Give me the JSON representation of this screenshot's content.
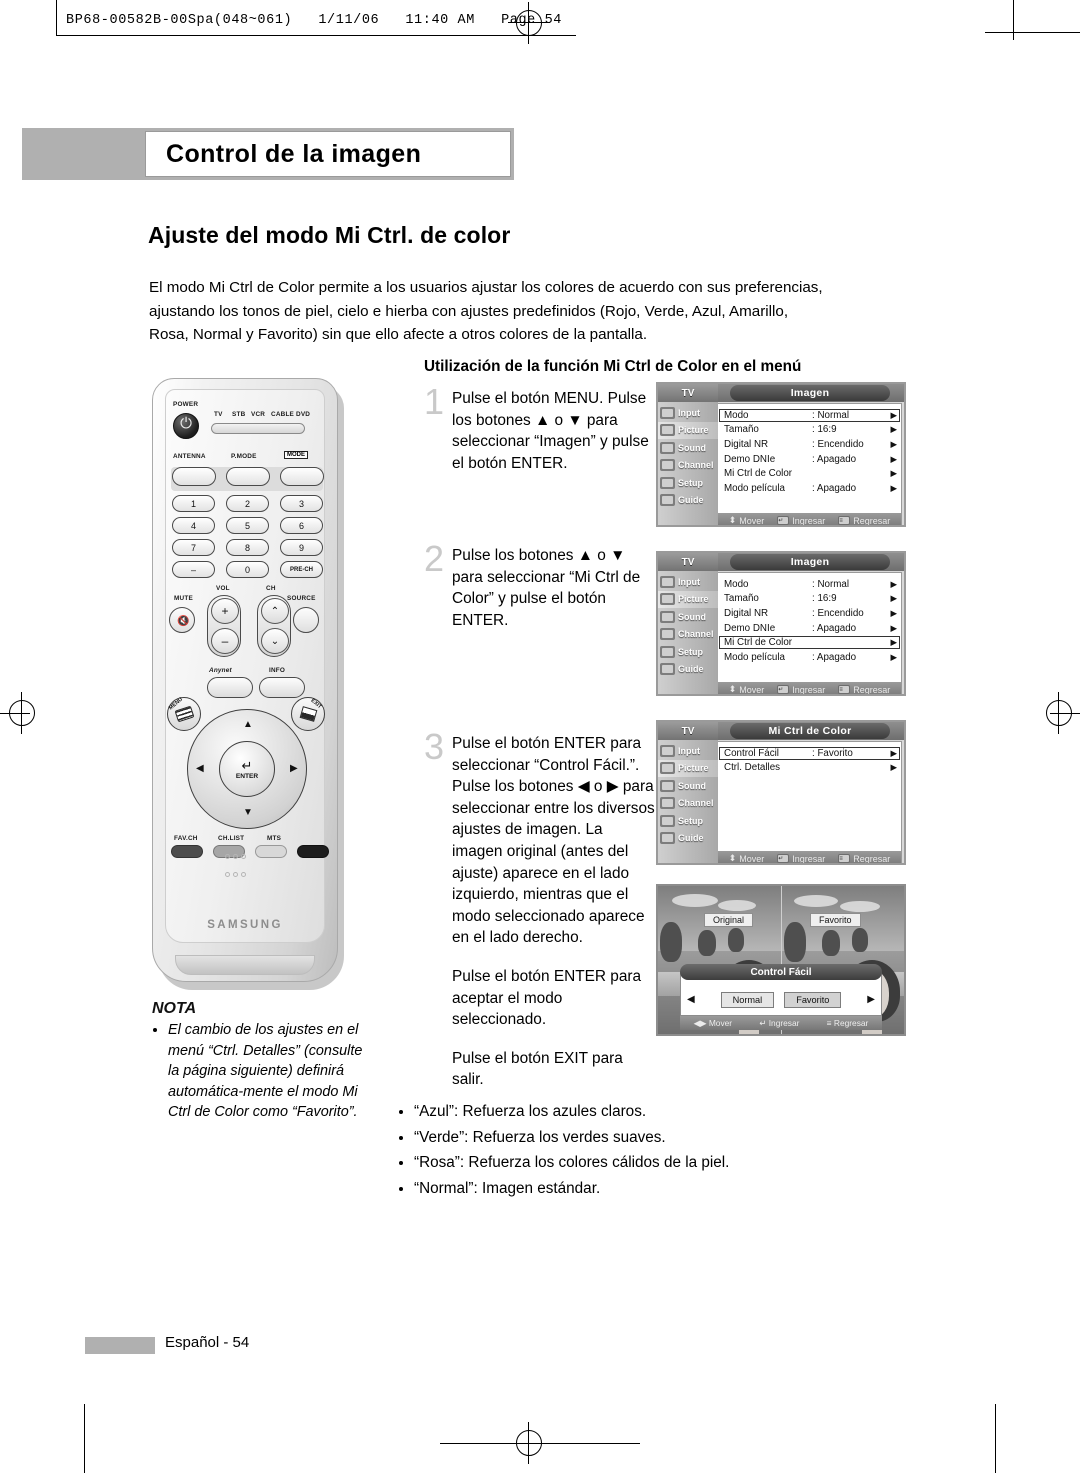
{
  "page_header": {
    "text": "BP68-00582B-00Spa(048~061)   1/11/06   11:40 AM   Page 54"
  },
  "chapter": {
    "title": "Control de la imagen"
  },
  "section": {
    "heading": "Ajuste del modo Mi Ctrl. de color"
  },
  "intro": {
    "lines": [
      "El modo Mi Ctrl de Color permite a los usuarios ajustar los colores de acuerdo con sus preferencias,",
      "ajustando los tonos de piel, cielo e hierba con ajustes predefinidos (Rojo, Verde, Azul, Amarillo,",
      "Rosa, Normal y Favorito) sin que ello afecte a otros colores de la pantalla."
    ]
  },
  "sub_heading": "Utilización de la función Mi Ctrl de Color en el menú",
  "steps": [
    {
      "number": "1",
      "paragraphs": [
        "Pulse el botón MENU.  Pulse los botones ▲ o ▼ para seleccionar “Imagen” y pulse el botón ENTER."
      ]
    },
    {
      "number": "2",
      "paragraphs": [
        "Pulse los botones ▲ o ▼ para seleccionar “Mi Ctrl de Color” y pulse el botón ENTER."
      ]
    },
    {
      "number": "3",
      "paragraphs": [
        "Pulse el botón ENTER para seleccionar “Control Fácil.”. Pulse los botones ◀ o ▶ para seleccionar entre los diversos ajustes de imagen. La imagen original (antes del ajuste) aparece en el lado izquierdo, mientras que el modo seleccionado aparece en el lado derecho.",
        "Pulse el botón ENTER para aceptar el modo seleccionado.",
        "Pulse el botón EXIT para salir."
      ]
    }
  ],
  "osd_sidebar": [
    {
      "label": "Input",
      "icon": "input-icon"
    },
    {
      "label": "Picture",
      "icon": "picture-icon"
    },
    {
      "label": "Sound",
      "icon": "sound-icon"
    },
    {
      "label": "Channel",
      "icon": "channel-icon"
    },
    {
      "label": "Setup",
      "icon": "setup-icon"
    },
    {
      "label": "Guide",
      "icon": "guide-icon"
    }
  ],
  "osd_footer": {
    "move": "Mover",
    "enter": "Ingresar",
    "return": "Regresar"
  },
  "osd_tv_label": "TV",
  "menus": [
    {
      "id": "osd1",
      "title": "Imagen",
      "active_side": "Picture",
      "rows": [
        {
          "label": "Modo",
          "value": ": Normal",
          "selected": true
        },
        {
          "label": "Tamaño",
          "value": ": 16:9",
          "selected": false
        },
        {
          "label": "Digital NR",
          "value": ": Encendido",
          "selected": false
        },
        {
          "label": "Demo DNIe",
          "value": ": Apagado",
          "selected": false
        },
        {
          "label": "Mi Ctrl de Color",
          "value": "",
          "selected": false
        },
        {
          "label": "Modo película",
          "value": ": Apagado",
          "selected": false
        }
      ]
    },
    {
      "id": "osd2",
      "title": "Imagen",
      "active_side": "Picture",
      "rows": [
        {
          "label": "Modo",
          "value": ": Normal",
          "selected": false
        },
        {
          "label": "Tamaño",
          "value": ": 16:9",
          "selected": false
        },
        {
          "label": "Digital NR",
          "value": ": Encendido",
          "selected": false
        },
        {
          "label": "Demo DNIe",
          "value": ": Apagado",
          "selected": false
        },
        {
          "label": "Mi Ctrl de Color",
          "value": "",
          "selected": true
        },
        {
          "label": "Modo película",
          "value": ": Apagado",
          "selected": false
        }
      ]
    },
    {
      "id": "osd3",
      "title": "Mi Ctrl de Color",
      "active_side": "Picture",
      "rows": [
        {
          "label": "Control Fácil",
          "value": ": Favorito",
          "selected": true
        },
        {
          "label": "Ctrl. Detalles",
          "value": "",
          "selected": false
        }
      ]
    }
  ],
  "preview": {
    "tag_left": "Original",
    "tag_right": "Favorito",
    "osd_title": "Control Fácil",
    "chips": [
      {
        "label": "Normal",
        "selected": true
      },
      {
        "label": "Favorito",
        "selected": false
      }
    ],
    "footer": {
      "move": "Mover",
      "enter": "Ingresar",
      "return": "Regresar"
    }
  },
  "nota": {
    "title": "NOTA",
    "items": [
      "El cambio de los ajustes en el menú “Ctrl. Detalles” (consulte la página siguiente) definirá automática-mente el modo Mi Ctrl de Color como “Favorito”."
    ]
  },
  "modes": [
    "“Azul”: Refuerza los azules claros.",
    "“Verde”: Refuerza los verdes suaves.",
    "“Rosa”: Refuerza los colores cálidos de la piel.",
    "“Normal”:  Imagen estándar."
  ],
  "footer": {
    "text": "Español - 54"
  },
  "remote": {
    "brand": "SAMSUNG",
    "power_label": "POWER",
    "device_modes": [
      "TV",
      "STB",
      "VCR",
      "CABLE",
      "DVD"
    ],
    "antenna_label": "ANTENNA",
    "pmode_label": "P.MODE",
    "mode_label": "MODE",
    "numbers": [
      "1",
      "2",
      "3",
      "4",
      "5",
      "6",
      "7",
      "8",
      "9",
      "–",
      "0",
      "PRE-CH"
    ],
    "vol_label": "VOL",
    "ch_label": "CH",
    "mute_label": "MUTE",
    "source_label": "SOURCE",
    "anynet_label": "Anynet",
    "info_label": "INFO",
    "menu_label": "MENU",
    "exit_label": "EXIT",
    "enter_label": "ENTER",
    "bottom_buttons": [
      "FAV.CH",
      "CH.LIST",
      "MTS"
    ]
  }
}
